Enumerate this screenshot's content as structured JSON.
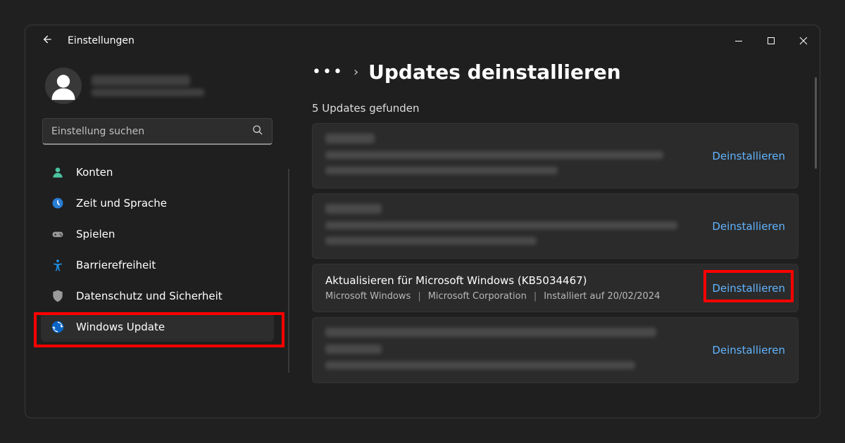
{
  "titlebar": {
    "app_name": "Einstellungen"
  },
  "search": {
    "placeholder": "Einstellung suchen"
  },
  "sidebar": {
    "items": [
      {
        "label": "Konten"
      },
      {
        "label": "Zeit und Sprache"
      },
      {
        "label": "Spielen"
      },
      {
        "label": "Barrierefreiheit"
      },
      {
        "label": "Datenschutz und Sicherheit"
      },
      {
        "label": "Windows Update"
      }
    ]
  },
  "breadcrumb": {
    "page_title": "Updates deinstallieren"
  },
  "subtitle": "5 Updates gefunden",
  "updates": [
    {
      "uninstall_label": "Deinstallieren"
    },
    {
      "uninstall_label": "Deinstallieren"
    },
    {
      "title": "Aktualisieren für Microsoft Windows (KB5034467)",
      "vendor": "Microsoft Windows",
      "publisher": "Microsoft Corporation",
      "installed_prefix": "Installiert auf ",
      "installed_date": "20/02/2024",
      "uninstall_label": "Deinstallieren"
    },
    {
      "uninstall_label": "Deinstallieren"
    }
  ]
}
